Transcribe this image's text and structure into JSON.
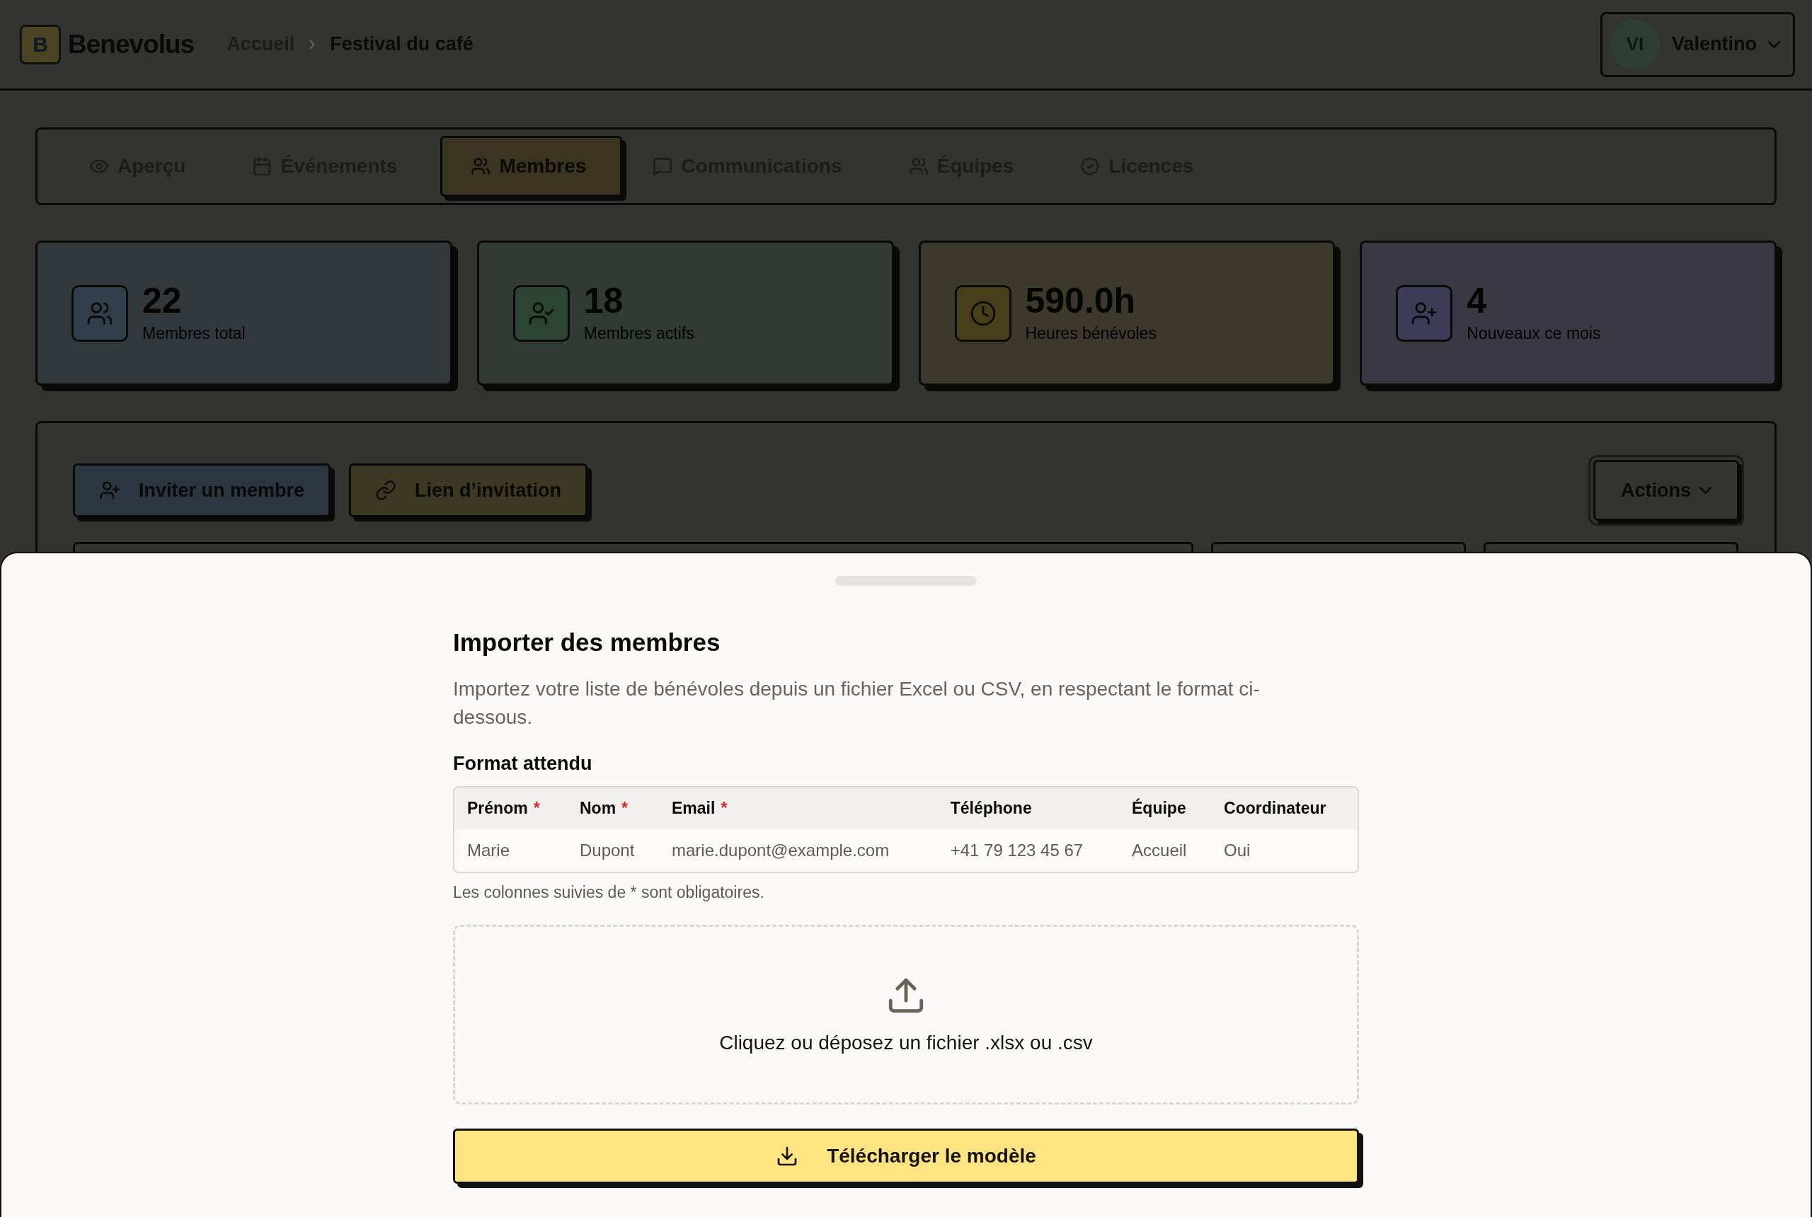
{
  "header": {
    "logo": {
      "mark": "B",
      "name": "Benevolus"
    },
    "breadcrumb": [
      "Accueil",
      "Festival du café"
    ],
    "user": {
      "initials": "VI",
      "name": "Valentino"
    }
  },
  "tabs": [
    {
      "label": "Aperçu",
      "selected": false
    },
    {
      "label": "Événements",
      "selected": false
    },
    {
      "label": "Membres",
      "selected": true
    },
    {
      "label": "Communications",
      "selected": false
    },
    {
      "label": "Équipes",
      "selected": false
    },
    {
      "label": "Licences",
      "selected": false
    }
  ],
  "stats": [
    {
      "value": "22",
      "label": "Membres total",
      "color": "#33383d"
    },
    {
      "value": "18",
      "label": "Membres actifs",
      "color": "#313a35"
    },
    {
      "value": "590.0h",
      "label": "Heures bénévoles",
      "color": "#3c392c"
    },
    {
      "value": "4",
      "label": "Nouveaux ce mois",
      "color": "#393843"
    }
  ],
  "toolbar": {
    "buttons": [
      {
        "label": "Inviter un membre",
        "color": "#2c3641"
      },
      {
        "label": "Lien d’invitation",
        "color": "#3d3823"
      }
    ],
    "actions": "Actions"
  },
  "import_sheet": {
    "title": "Importer des membres",
    "description": "Importez votre liste de bénévoles depuis un fichier Excel ou CSV, en respectant le format ci-dessous.",
    "format_heading": "Format attendu",
    "columns": [
      {
        "label": "Prénom",
        "required_mark": "*"
      },
      {
        "label": "Nom",
        "required_mark": "*"
      },
      {
        "label": "Email",
        "required_mark": "*"
      },
      {
        "label": "Téléphone"
      },
      {
        "label": "Équipe"
      },
      {
        "label": "Coordinateur"
      }
    ],
    "rows": [
      [
        "Marie",
        "Dupont",
        "marie.dupont@example.com",
        "+41 79 123 45 67",
        "Accueil",
        "Oui"
      ]
    ],
    "note": "Les colonnes suivies de * sont obligatoires.",
    "dropzone": "Cliquez ou déposez un fichier .xlsx ou .csv",
    "download_button": "Télécharger le modèle"
  }
}
